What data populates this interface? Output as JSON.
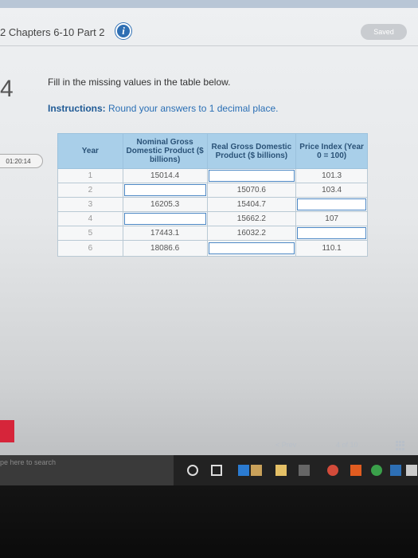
{
  "header": {
    "title": "2 Chapters 6-10 Part 2",
    "saved_label": "Saved"
  },
  "question": {
    "number": "4",
    "timer": "01:20:14",
    "prompt": "Fill in the missing values in the table below.",
    "instructions_label": "Instructions:",
    "instructions_text": " Round your answers to 1 decimal place."
  },
  "table": {
    "headers": {
      "year": "Year",
      "nominal": "Nominal Gross Domestic Product ($ billions)",
      "real": "Real Gross Domestic Product ($ billions)",
      "price": "Price Index (Year 0 = 100)"
    },
    "rows": [
      {
        "year": "1",
        "nominal": "15014.4",
        "real": "",
        "price": "101.3"
      },
      {
        "year": "2",
        "nominal": "",
        "real": "15070.6",
        "price": "103.4"
      },
      {
        "year": "3",
        "nominal": "16205.3",
        "real": "15404.7",
        "price": ""
      },
      {
        "year": "4",
        "nominal": "",
        "real": "15662.2",
        "price": "107"
      },
      {
        "year": "5",
        "nominal": "17443.1",
        "real": "16032.2",
        "price": ""
      },
      {
        "year": "6",
        "nominal": "18086.6",
        "real": "",
        "price": "110.1"
      }
    ]
  },
  "footer": {
    "prev_label": "< Prev",
    "page_indicator": "4 of 10"
  },
  "taskbar": {
    "search_placeholder": "pe here to search"
  }
}
